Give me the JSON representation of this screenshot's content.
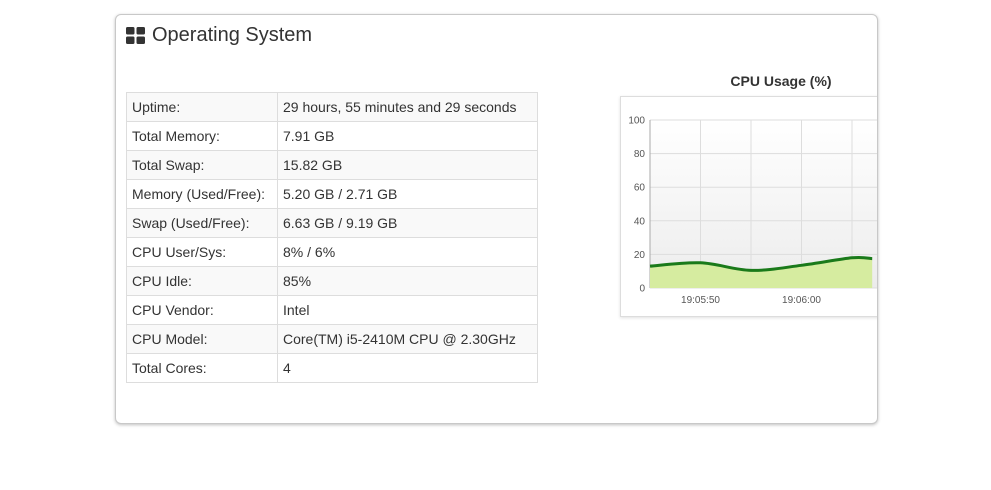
{
  "panel": {
    "title": "Operating System",
    "icon": "grid-icon"
  },
  "system_info": [
    {
      "label": "Uptime:",
      "value": "29 hours, 55 minutes and 29 seconds"
    },
    {
      "label": "Total Memory:",
      "value": "7.91 GB"
    },
    {
      "label": "Total Swap:",
      "value": "15.82 GB"
    },
    {
      "label": "Memory (Used/Free):",
      "value": "5.20 GB / 2.71 GB"
    },
    {
      "label": "Swap (Used/Free):",
      "value": "6.63 GB / 9.19 GB"
    },
    {
      "label": "CPU User/Sys:",
      "value": "8% / 6%"
    },
    {
      "label": "CPU Idle:",
      "value": "85%"
    },
    {
      "label": "CPU Vendor:",
      "value": "Intel"
    },
    {
      "label": "CPU Model:",
      "value": "Core(TM) i5-2410M CPU @ 2.30GHz"
    },
    {
      "label": "Total Cores:",
      "value": "4"
    }
  ],
  "colors": {
    "line": "#1a7a1a",
    "fill": "#d6eca0",
    "grid": "#dddddd"
  },
  "chart_data": {
    "type": "area",
    "title": "CPU Usage (%)",
    "xlabel": "",
    "ylabel": "",
    "ylim": [
      0,
      100
    ],
    "yticks": [
      "0",
      "20",
      "40",
      "60",
      "80",
      "100"
    ],
    "xticks": [
      "19:05:50",
      "19:06:00"
    ],
    "grid": true,
    "series": [
      {
        "x": [
          "19:05:45",
          "19:05:50",
          "19:05:55",
          "19:06:00",
          "19:06:05",
          "19:06:07"
        ],
        "values": [
          13,
          15,
          10.5,
          13.5,
          18,
          17.5
        ]
      }
    ]
  }
}
